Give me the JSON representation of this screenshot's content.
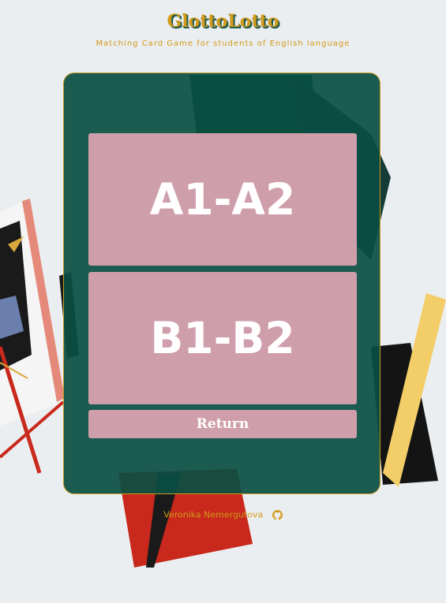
{
  "header": {
    "title": "GlottoLotto",
    "subtitle": "Matching Card Game for students of English language"
  },
  "menu": {
    "level_a": "A1-A2",
    "level_b": "B1-B2",
    "return_label": "Return"
  },
  "footer": {
    "author": "Veronika Nemergutova",
    "icon": "github-icon"
  },
  "colors": {
    "accent": "#d29a1a",
    "panel": "#0a4e42",
    "button": "#cf9eab"
  }
}
